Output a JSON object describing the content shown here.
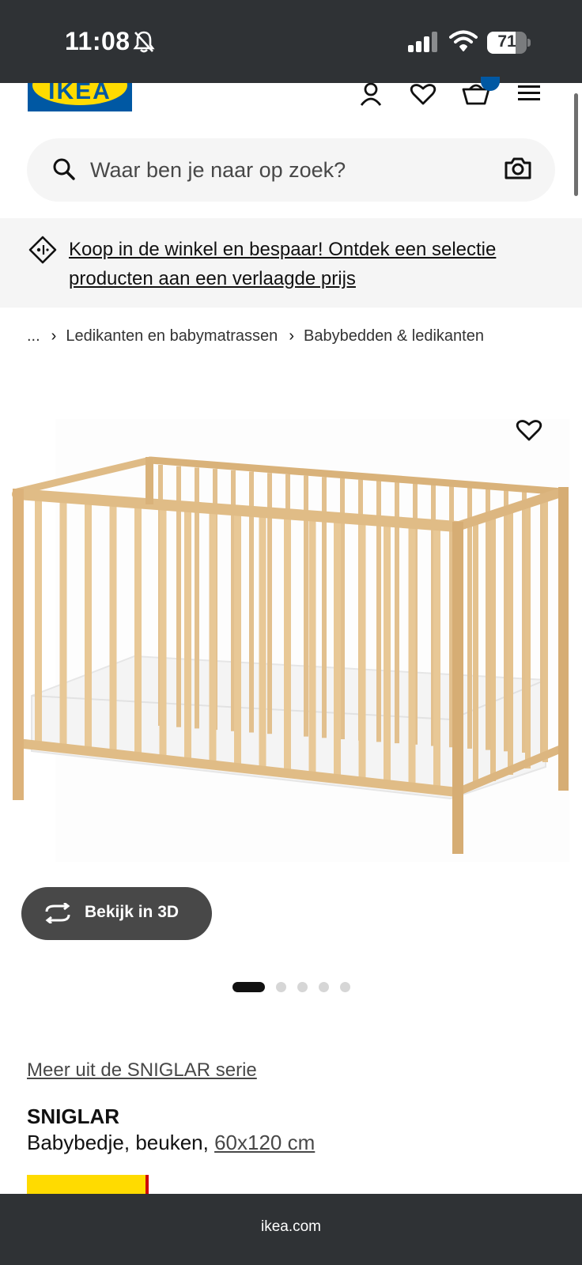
{
  "status_bar": {
    "time": "11:08",
    "battery_text": "71",
    "battery_level": 0.71
  },
  "header": {
    "logo_text": "IKEA",
    "icons": [
      "user-icon",
      "heart-icon",
      "cart-icon",
      "menu-icon"
    ]
  },
  "search": {
    "placeholder": "Waar ben je naar op zoek?"
  },
  "promo": {
    "text": "Koop in de winkel en bespaar! Ontdek een selectie producten aan een verlaagde prijs"
  },
  "breadcrumb": {
    "ellipsis": "...",
    "items": [
      "Ledikanten en babymatrassen",
      "Babybedden & ledikanten"
    ]
  },
  "gallery": {
    "view_3d_label": "Bekijk in 3D",
    "image_count": 5,
    "active_index": 0
  },
  "product": {
    "series_link": "Meer uit de SNIGLAR serie",
    "name": "SNIGLAR",
    "description": "Babybedje, beuken,",
    "size": "60x120 cm"
  },
  "browser": {
    "url": "ikea.com"
  },
  "colors": {
    "ikea_blue": "#0058a3",
    "ikea_yellow": "#ffdb00",
    "dark_bar": "#2f3235",
    "wood": "#e8c896"
  }
}
